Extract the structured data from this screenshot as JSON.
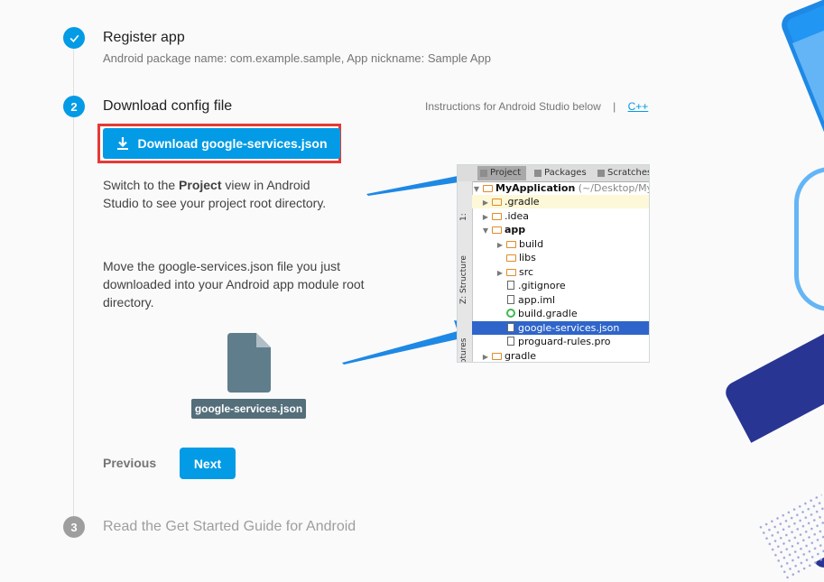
{
  "steps": [
    {
      "number": "✓",
      "title": "Register app",
      "subtitle": "Android package name: com.example.sample, App nickname: Sample App"
    },
    {
      "number": "2",
      "title": "Download config file",
      "instructions_text": "Instructions for Android Studio below",
      "separator": "|",
      "alt_link": "C++"
    },
    {
      "number": "3",
      "title": "Read the Get Started Guide for Android"
    }
  ],
  "download": {
    "label": "Download google-services.json"
  },
  "switch_text": {
    "before": "Switch to the ",
    "bold": "Project",
    "after": " view in Android Studio to see your project root directory."
  },
  "move_text": "Move the google-services.json file you just downloaded into your Android app module root directory.",
  "file_chip": "google-services.json",
  "nav": {
    "previous": "Previous",
    "next": "Next"
  },
  "studio": {
    "tabs": [
      "Project",
      "Packages",
      "Scratches"
    ],
    "side_labels": [
      "1:",
      "Z: Structure",
      "Captures"
    ],
    "tree": [
      {
        "name": "MyApplication",
        "suffix": "(~/Desktop/My"
      },
      {
        "name": ".gradle"
      },
      {
        "name": ".idea"
      },
      {
        "name": "app"
      },
      {
        "name": "build"
      },
      {
        "name": "libs"
      },
      {
        "name": "src"
      },
      {
        "name": ".gitignore"
      },
      {
        "name": "app.iml"
      },
      {
        "name": "build.gradle"
      },
      {
        "name": "google-services.json"
      },
      {
        "name": "proguard-rules.pro"
      },
      {
        "name": "gradle"
      }
    ]
  },
  "colors": {
    "accent": "#039be5",
    "highlight_border": "#e53935",
    "step_done": "#039be5",
    "step_pending": "#9e9e9e"
  }
}
